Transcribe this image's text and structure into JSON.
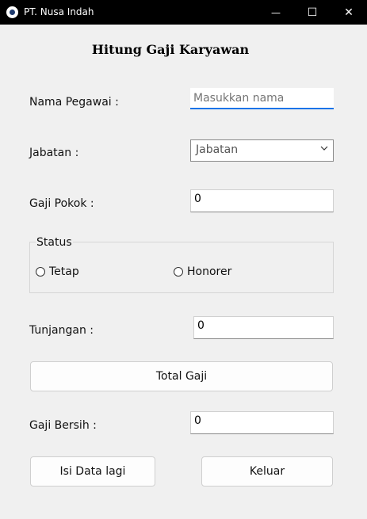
{
  "window": {
    "title": "PT. Nusa Indah",
    "controls": {
      "minimize": "—",
      "maximize": "☐",
      "close": "✕"
    }
  },
  "form": {
    "heading": "Hitung Gaji Karyawan",
    "nama_label": "Nama Pegawai :",
    "nama_placeholder": "Masukkan nama",
    "jabatan_label": "Jabatan :",
    "jabatan_selected": "Jabatan",
    "gaji_pokok_label": "Gaji Pokok :",
    "gaji_pokok_value": "0",
    "status_title": "Status",
    "status_options": [
      "Tetap",
      "Honorer"
    ],
    "tunjangan_label": "Tunjangan :",
    "tunjangan_value": "0",
    "total_button": "Total Gaji",
    "gaji_bersih_label": "Gaji Bersih :",
    "gaji_bersih_value": "0",
    "reset_button": "Isi Data lagi",
    "exit_button": "Keluar"
  },
  "colors": {
    "titlebar": "#000000",
    "window_bg": "#f0f0f0",
    "focus_accent": "#1a73e8"
  },
  "icons": {
    "app": "app-icon",
    "dropdown": "chevron-down-icon"
  }
}
